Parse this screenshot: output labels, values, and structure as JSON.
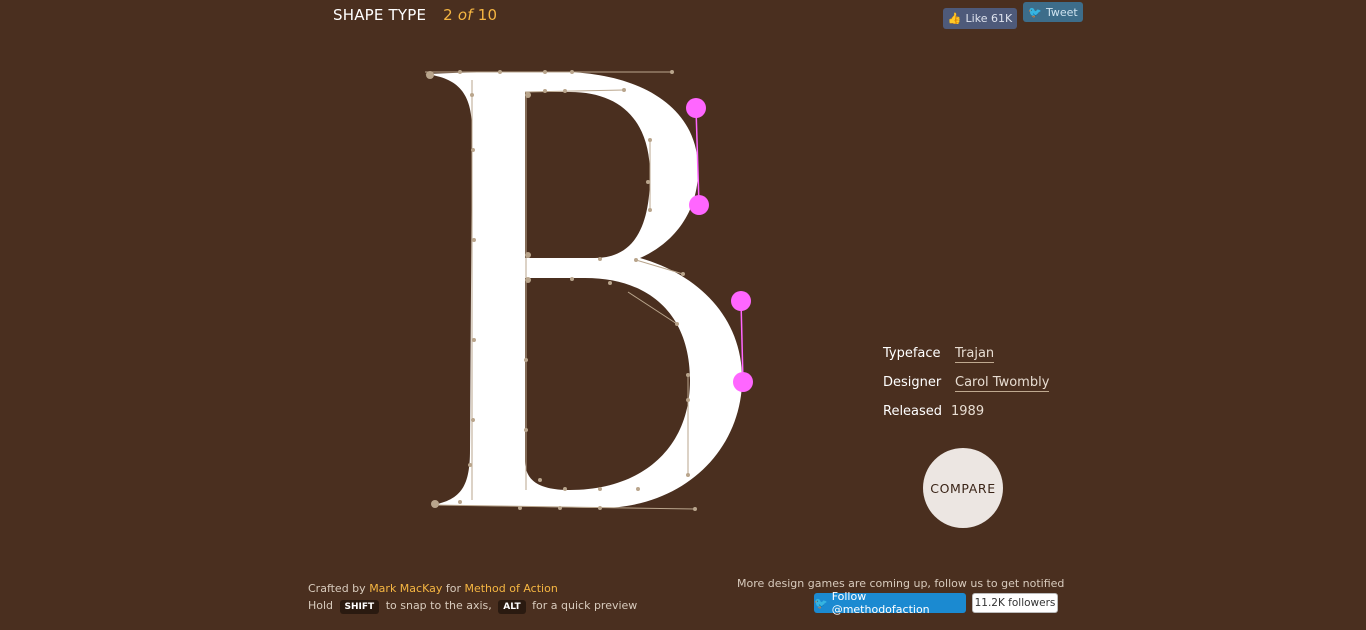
{
  "header": {
    "title": "SHAPE TYPE",
    "counter_current": "2",
    "counter_of": "of",
    "counter_total": "10"
  },
  "social": {
    "like_label": "Like 61K",
    "tweet_label": "Tweet"
  },
  "glyph": {
    "letter": "B",
    "handle_color": "#ff66ff",
    "fill_color": "#ffffff",
    "outline_color": "#b9a58c"
  },
  "info": {
    "typeface_label": "Typeface",
    "typeface_value": "Trajan",
    "designer_label": "Designer",
    "designer_value": "Carol Twombly",
    "released_label": "Released",
    "released_value": "1989"
  },
  "compare_label": "COMPARE",
  "footer": {
    "crafted_prefix": "Crafted by",
    "author": "Mark MacKay",
    "for_text": "for",
    "org": "Method of Action",
    "hold_text": "Hold",
    "shift_key": "SHIFT",
    "shift_desc": "to snap to the axis,",
    "alt_key": "ALT",
    "alt_desc": "for a quick preview",
    "notify_text": "More design games are coming up, follow us to get notified",
    "follow_label": "Follow @methodofaction",
    "followers_label": "11.2K followers"
  }
}
